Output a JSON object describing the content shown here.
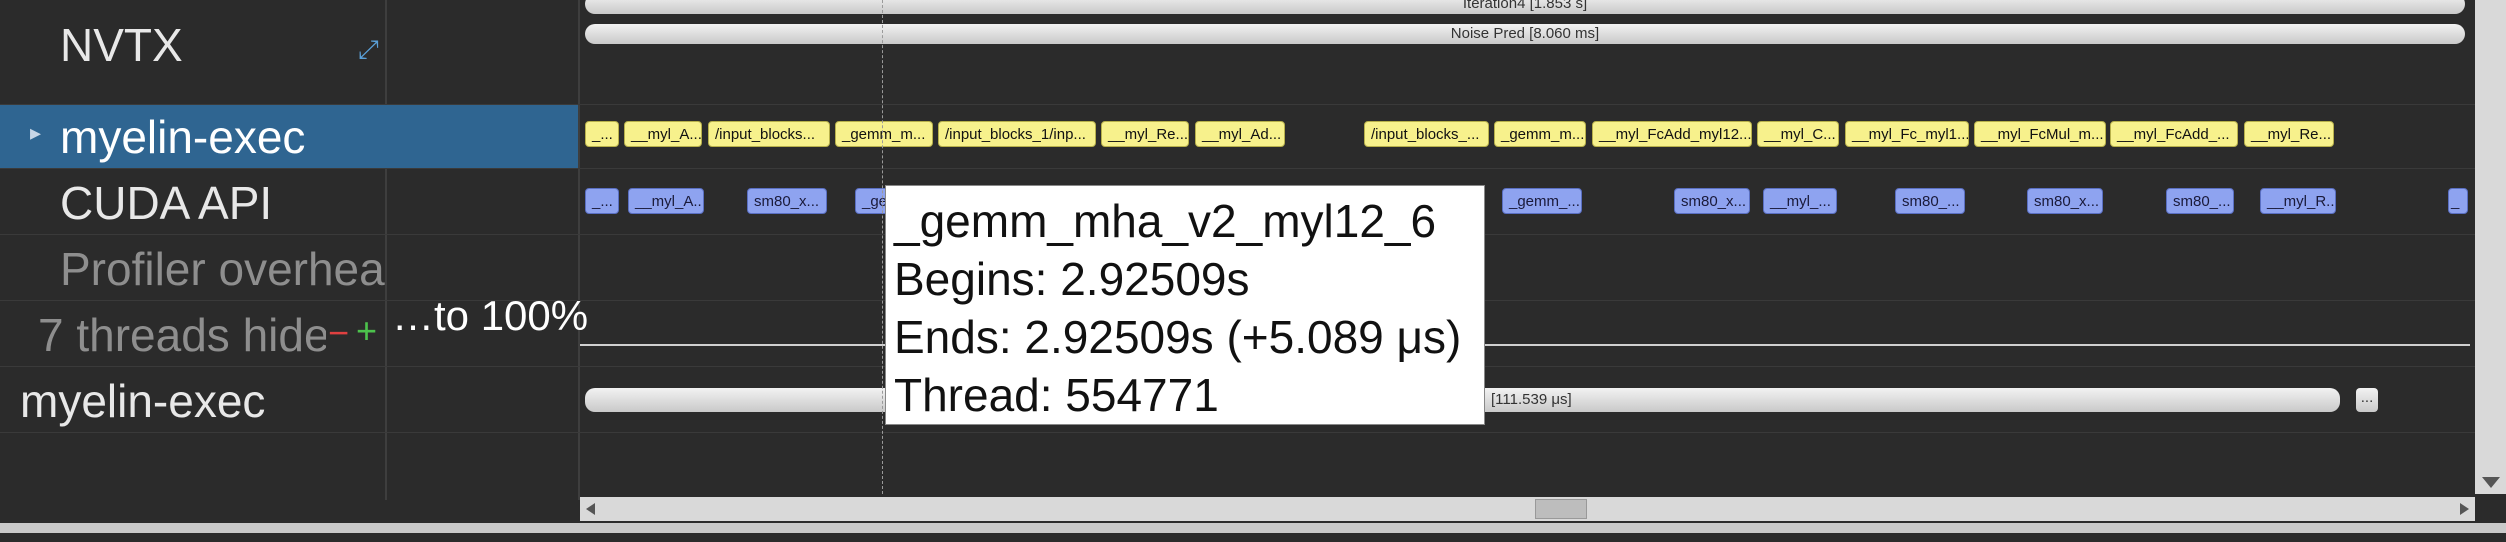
{
  "rows": {
    "nvtx": "NVTX",
    "myelin_exec_top": "myelin-exec",
    "cuda_api": "CUDA API",
    "profiler_overhead": "Profiler overhea",
    "threads_hidden": "7 threads hidе",
    "myelin_exec_bottom": "myelin-exec"
  },
  "zoom_text": "…to 100%",
  "minus": "−",
  "plus": "+",
  "nvtx_bars": {
    "iteration": "Iteration4 [1.853 s]",
    "noise_pred": "Noise Pred [8.060 ms]"
  },
  "bottom_bar": {
    "label": "[111.539 μs]",
    "more": "..."
  },
  "yellow_chips": [
    "_...",
    "__myl_A...",
    "/input_blocks...",
    "_gemm_m...",
    "/input_blocks_1/inp...",
    "__myl_Re...",
    "__myl_Ad...",
    "/input_blocks_...",
    "_gemm_m...",
    "__myl_FcAdd_myl12...",
    "__myl_C...",
    "__myl_Fc_myl1...",
    "__myl_FcMul_m...",
    "__myl_FcAdd_...",
    "__myl_Re..."
  ],
  "blue_chips": [
    "_...",
    "__myl_A...",
    "sm80_x...",
    "_ge",
    "_gemm_...",
    "sm80_x...",
    "__myl_...",
    "sm80_...",
    "sm80_x...",
    "sm80_...",
    "__myl_R...",
    "_"
  ],
  "tooltip": {
    "title": "_gemm_mha_v2_myl12_6",
    "begins": "Begins: 2.92509s",
    "ends": "Ends: 2.92509s (+5.089 μs)",
    "thread": "Thread: 554771"
  },
  "colors": {
    "selected_row": "#2f6591",
    "yellow": "#f7f18c",
    "blue": "#8ea3f0"
  }
}
